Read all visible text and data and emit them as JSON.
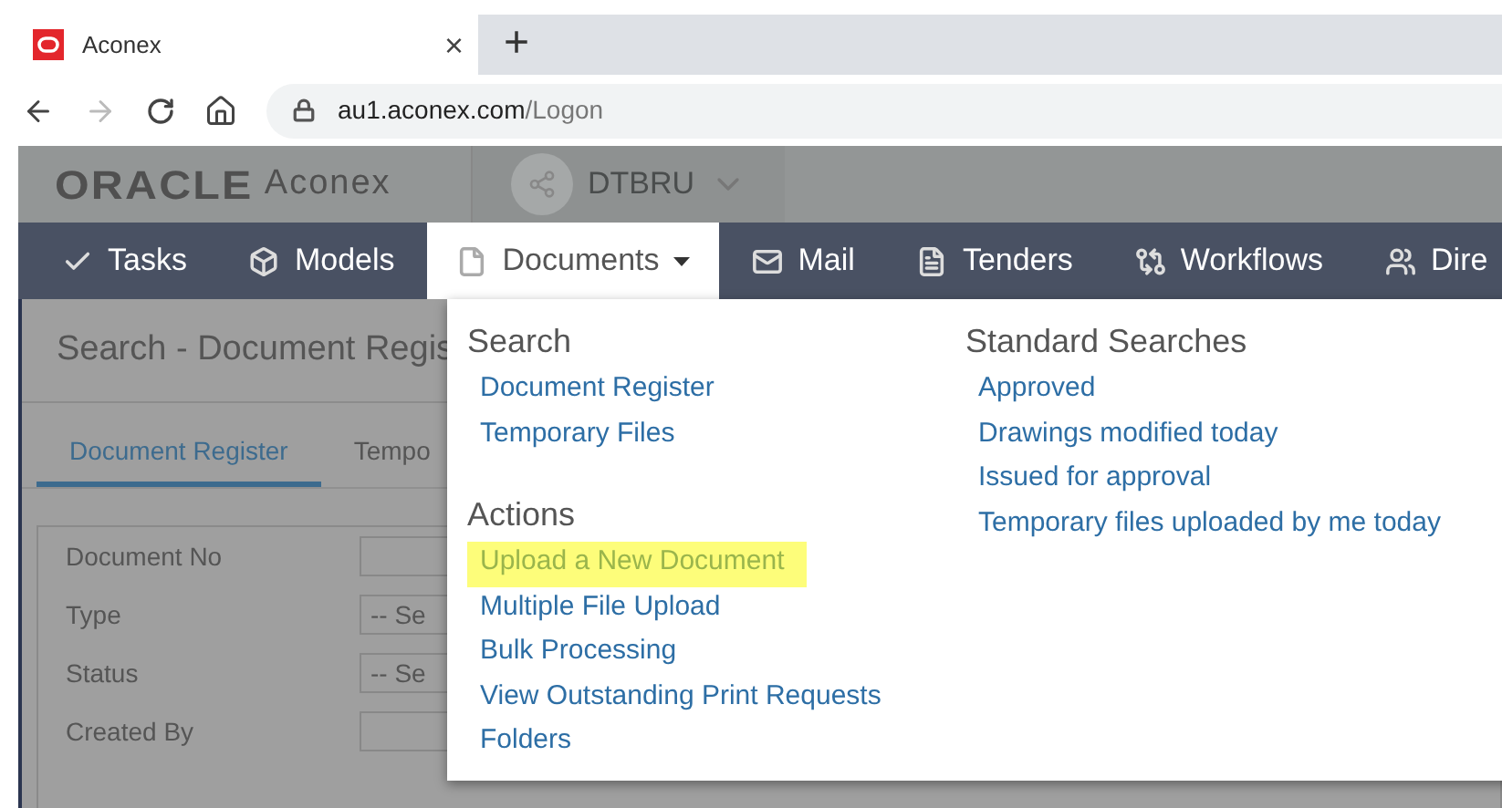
{
  "browser": {
    "tab": {
      "title": "Aconex",
      "close": "×"
    },
    "new_tab": "+",
    "url": {
      "host": "au1.aconex.com",
      "path": "/Logon"
    }
  },
  "header": {
    "logo": {
      "brand": "ORACLE",
      "product": "Aconex"
    },
    "project": "DTBRU"
  },
  "nav": [
    {
      "label": "Tasks",
      "selected": false,
      "dropdown": false
    },
    {
      "label": "Models",
      "selected": false,
      "dropdown": false
    },
    {
      "label": "Documents",
      "selected": true,
      "dropdown": true
    },
    {
      "label": "Mail",
      "selected": false,
      "dropdown": false
    },
    {
      "label": "Tenders",
      "selected": false,
      "dropdown": false
    },
    {
      "label": "Workflows",
      "selected": false,
      "dropdown": false
    },
    {
      "label": "Dire",
      "selected": false,
      "dropdown": false
    }
  ],
  "page": {
    "title": "Search - Document Regis",
    "tabs": [
      {
        "label": "Document Register",
        "selected": true
      },
      {
        "label": "Tempo",
        "selected": false
      }
    ],
    "fields": [
      {
        "label": "Document No",
        "kind": "text"
      },
      {
        "label": "Type",
        "kind": "select",
        "value": "-- Se"
      },
      {
        "label": "Status",
        "kind": "select",
        "value": "-- Se"
      },
      {
        "label": "Created By",
        "kind": "text"
      }
    ]
  },
  "menu": {
    "columns": [
      {
        "sections": [
          {
            "heading": "Search",
            "items": [
              {
                "label": "Document Register",
                "highlighted": false
              },
              {
                "label": "Temporary Files",
                "highlighted": false
              }
            ]
          },
          {
            "heading": "Actions",
            "items": [
              {
                "label": "Upload a New Document",
                "highlighted": true
              },
              {
                "label": "Multiple File Upload",
                "highlighted": false
              },
              {
                "label": "Bulk Processing",
                "highlighted": false
              },
              {
                "label": "View Outstanding Print Requests",
                "highlighted": false
              },
              {
                "label": "Folders",
                "highlighted": false
              }
            ]
          }
        ]
      },
      {
        "sections": [
          {
            "heading": "Standard Searches",
            "items": [
              {
                "label": "Approved",
                "highlighted": false
              },
              {
                "label": "Drawings modified today",
                "highlighted": false
              },
              {
                "label": "Issued for approval",
                "highlighted": false
              },
              {
                "label": "Temporary files uploaded by me today",
                "highlighted": false
              }
            ]
          }
        ]
      }
    ]
  }
}
